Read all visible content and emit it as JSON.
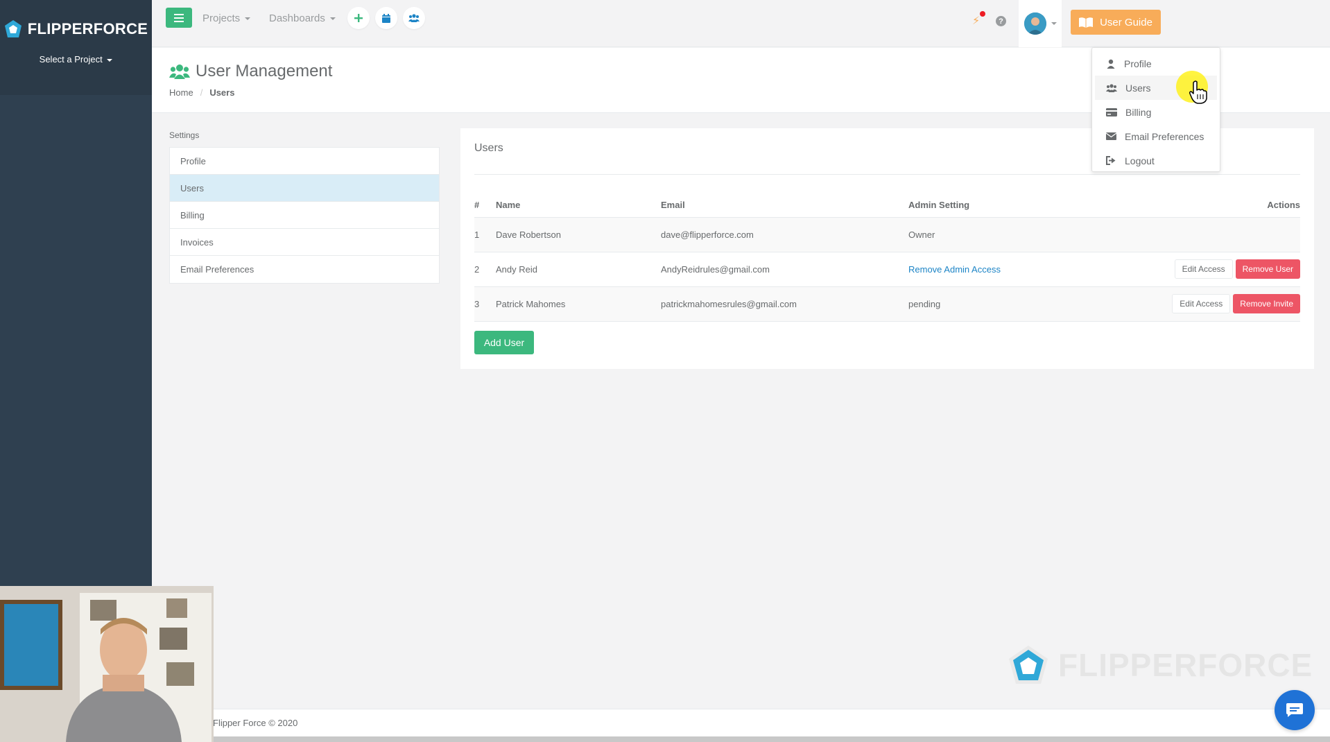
{
  "brand": {
    "name": "FLIPPERFORCE"
  },
  "sidebar": {
    "project_select": "Select a Project"
  },
  "topnav": {
    "projects": "Projects",
    "dashboards": "Dashboards",
    "user_guide": "User Guide",
    "help": "?"
  },
  "page": {
    "title": "User Management",
    "breadcrumb": {
      "home": "Home",
      "sep": "/",
      "current": "Users"
    }
  },
  "settings": {
    "label": "Settings",
    "items": [
      {
        "label": "Profile"
      },
      {
        "label": "Users"
      },
      {
        "label": "Billing"
      },
      {
        "label": "Invoices"
      },
      {
        "label": "Email Preferences"
      }
    ]
  },
  "users_panel": {
    "title": "Users",
    "columns": {
      "num": "#",
      "name": "Name",
      "email": "Email",
      "admin": "Admin Setting",
      "actions": "Actions"
    },
    "rows": [
      {
        "num": "1",
        "name": "Dave Robertson",
        "email": "dave@flipperforce.com",
        "admin": "Owner",
        "edit": "",
        "remove": ""
      },
      {
        "num": "2",
        "name": "Andy Reid",
        "email": "AndyReidrules@gmail.com",
        "admin": "Remove Admin Access",
        "edit": "Edit Access",
        "remove": "Remove User"
      },
      {
        "num": "3",
        "name": "Patrick Mahomes",
        "email": "patrickmahomesrules@gmail.com",
        "admin": "pending",
        "edit": "Edit Access",
        "remove": "Remove Invite"
      }
    ],
    "add_user": "Add User"
  },
  "user_menu": {
    "items": [
      {
        "label": "Profile",
        "icon": "user-icon"
      },
      {
        "label": "Users",
        "icon": "users-icon"
      },
      {
        "label": "Billing",
        "icon": "credit-card-icon"
      },
      {
        "label": "Email Preferences",
        "icon": "envelope-icon"
      },
      {
        "label": "Logout",
        "icon": "sign-out-icon"
      }
    ]
  },
  "footer": {
    "text": "Flipper Force © 2020"
  },
  "colors": {
    "sidebar": "#2f4050",
    "primary": "#3cb87e",
    "warning": "#f8ac59",
    "danger": "#ed5565",
    "link": "#1c84c6"
  }
}
